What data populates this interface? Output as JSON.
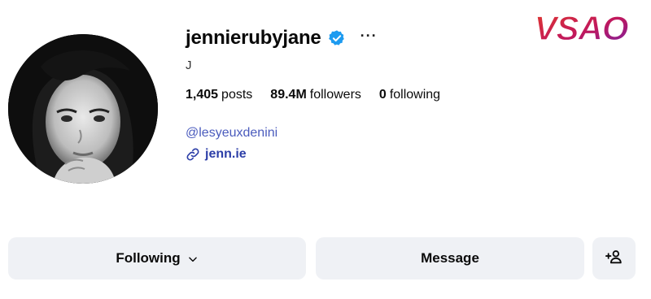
{
  "profile": {
    "username": "jennierubyjane",
    "full_name": "J",
    "more_label": "···",
    "stats": {
      "posts_count": "1,405",
      "posts_label": "posts",
      "followers_count": "89.4M",
      "followers_label": "followers",
      "following_count": "0",
      "following_label": "following"
    },
    "mention": "@lesyeuxdenini",
    "link_text": "jenn.ie",
    "verified": true
  },
  "actions": {
    "following_label": "Following",
    "message_label": "Message"
  },
  "watermark": {
    "text": "VSAO"
  },
  "icons": {
    "verified": "verified-badge-icon",
    "more": "more-options-icon",
    "link": "link-chain-icon",
    "chevron": "chevron-down-icon",
    "add_user": "add-user-icon"
  },
  "colors": {
    "verified_blue": "#1d9bf0",
    "link_blue": "#2d3fa8",
    "mention_blue": "#4a5bbd",
    "button_bg": "#eff1f5"
  }
}
